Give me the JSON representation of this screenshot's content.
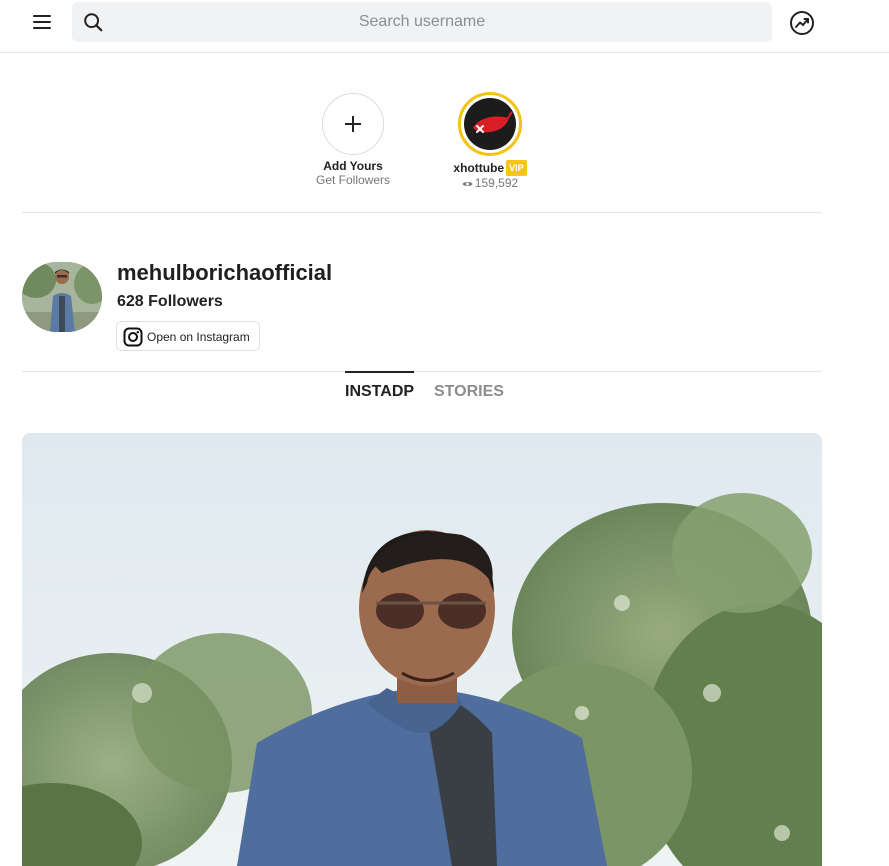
{
  "header": {
    "menu_icon": "hamburger-menu-icon",
    "search_icon": "search-icon",
    "search_placeholder": "Search username",
    "search_value": "",
    "trending_icon": "trending-up-icon"
  },
  "stories": [
    {
      "name": "Add Yours",
      "sub": "Get Followers",
      "icon": "plus-icon"
    },
    {
      "name": "xhottube",
      "badge": "VIP",
      "views": "159,592",
      "views_icon": "eye-icon",
      "ring_color": "#f1c40f"
    }
  ],
  "profile": {
    "username": "mehulborichaofficial",
    "followers": "628 Followers",
    "open_button": "Open on Instagram",
    "open_icon": "instagram-icon"
  },
  "tabs": [
    {
      "label": "INSTADP",
      "active": true
    },
    {
      "label": "STORIES",
      "active": false
    }
  ],
  "colors": {
    "vip": "#f5c518",
    "active_tab": "#222222",
    "inactive_tab": "#8c8c8c"
  }
}
